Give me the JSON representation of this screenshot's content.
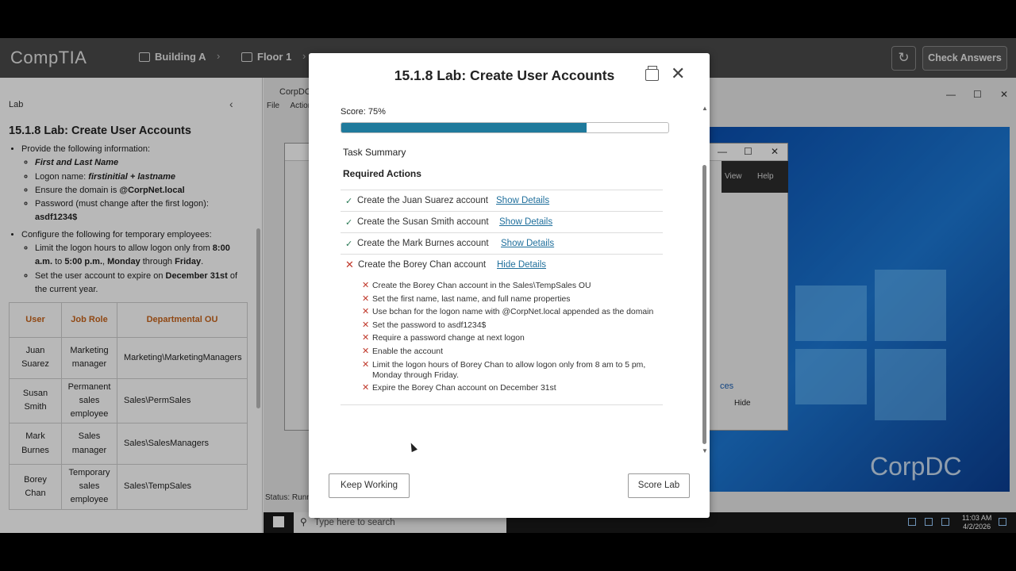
{
  "topbar": {
    "logo": "CompTIA",
    "crumbs": [
      "Building A",
      "Floor 1"
    ],
    "check_answers": "Check Answers"
  },
  "lab": {
    "header": "Lab",
    "title": "15.1.8 Lab: Create User Accounts",
    "instructions": {
      "provide": "Provide the following information:",
      "first_last": "First and Last Name",
      "logon_label": "Logon name: ",
      "logon_value": "firstinitial + lastname",
      "domain_label": "Ensure the domain is ",
      "domain_value": "@CorpNet.local",
      "password_label": "Password (must change after the first logon): ",
      "password_value": "asdf1234$",
      "configure": "Configure the following for temporary employees:",
      "limit_pre": "Limit the logon hours to allow logon only from ",
      "limit_from": "8:00 a.m.",
      "limit_to_word": " to ",
      "limit_to": "5:00 p.m.",
      "limit_comma": ", ",
      "limit_mon": "Monday",
      "limit_through": " through ",
      "limit_fri": "Friday",
      "limit_end": ".",
      "expire_pre": "Set the user account to expire on ",
      "expire_date": "December 31st",
      "expire_post": " of the current year."
    },
    "table": {
      "headers": [
        "User",
        "Job Role",
        "Departmental OU"
      ],
      "rows": [
        {
          "user": "Juan Suarez",
          "role": "Marketing manager",
          "ou": "Marketing\\MarketingManagers"
        },
        {
          "user": "Susan Smith",
          "role": "Permanent sales employee",
          "ou": "Sales\\PermSales"
        },
        {
          "user": "Mark Burnes",
          "role": "Sales manager",
          "ou": "Sales\\SalesManagers"
        },
        {
          "user": "Borey Chan",
          "role": "Temporary sales employee",
          "ou": "Sales\\TempSales"
        }
      ]
    }
  },
  "desktop": {
    "window_title": "CorpDC",
    "menu": [
      "File",
      "Action"
    ],
    "ribbon": [
      "View",
      "Help"
    ],
    "partial_link": "ces",
    "hide": "Hide",
    "status": "Status: Runni",
    "search_placeholder": "Type here to search",
    "time": "11:03 AM",
    "date": "4/2/2026",
    "wallpaper_text": "CorpDC"
  },
  "modal": {
    "title": "15.1.8 Lab: Create User Accounts",
    "score_text": "Score: 75%",
    "score": 75,
    "task_summary": "Task Summary",
    "required_actions": "Required Actions",
    "actions": [
      {
        "label": "Create the Juan Suarez account",
        "status": "pass",
        "link": "Show Details"
      },
      {
        "label": "Create the Susan Smith account",
        "status": "pass",
        "link": "Show Details"
      },
      {
        "label": "Create the Mark Burnes account",
        "status": "pass",
        "link": "Show Details"
      },
      {
        "label": "Create the Borey Chan account",
        "status": "fail",
        "link": "Hide Details"
      }
    ],
    "details": [
      "Create the Borey Chan account in the Sales\\TempSales OU",
      "Set the first name, last name, and full name properties",
      "Use bchan for the logon name with @CorpNet.local appended as the domain",
      "Set the password to asdf1234$",
      "Require a password change at next logon",
      "Enable the account",
      "Limit the logon hours of Borey Chan to allow logon only from 8 am to 5 pm, Monday through Friday.",
      "Expire the Borey Chan account on December 31st"
    ],
    "keep_working": "Keep Working",
    "score_lab": "Score Lab"
  },
  "colors": {
    "progress": "#1f7a9c",
    "pass": "#2a7a55",
    "fail": "#c0392b",
    "link": "#1f6f9c",
    "table_header": "#c8651c"
  }
}
